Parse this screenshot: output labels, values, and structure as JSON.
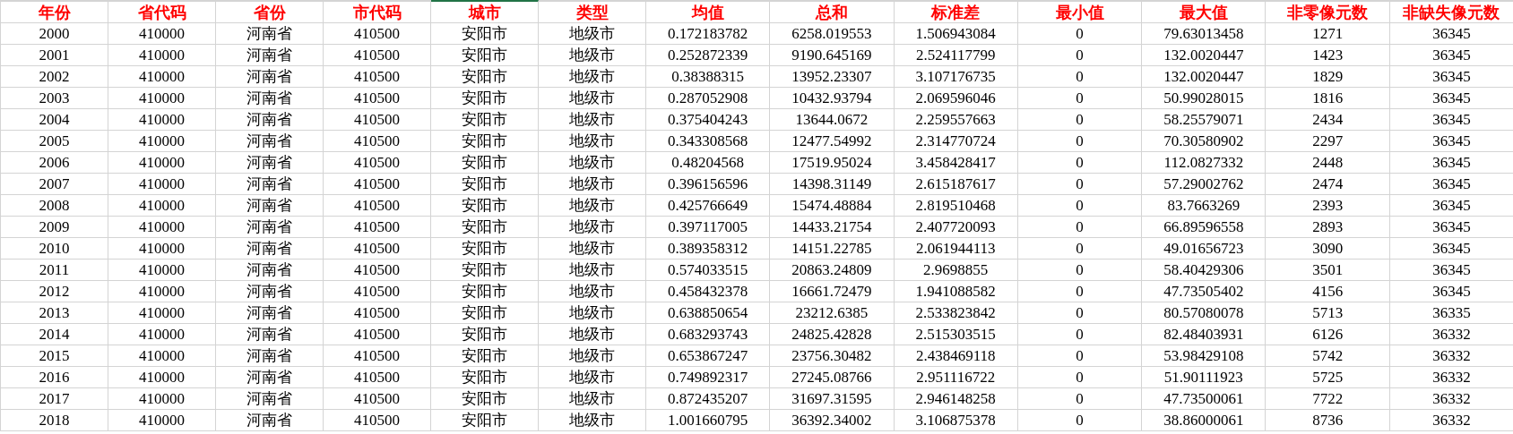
{
  "table": {
    "columns": [
      {
        "label": "年份",
        "selected": false
      },
      {
        "label": "省代码",
        "selected": false
      },
      {
        "label": "省份",
        "selected": false
      },
      {
        "label": "市代码",
        "selected": false
      },
      {
        "label": "城市",
        "selected": true
      },
      {
        "label": "类型",
        "selected": false
      },
      {
        "label": "均值",
        "selected": false
      },
      {
        "label": "总和",
        "selected": false
      },
      {
        "label": "标准差",
        "selected": false
      },
      {
        "label": "最小值",
        "selected": false
      },
      {
        "label": "最大值",
        "selected": false
      },
      {
        "label": "非零像元数",
        "selected": false
      },
      {
        "label": "非缺失像元数",
        "selected": false
      }
    ],
    "rows": [
      [
        "2000",
        "410000",
        "河南省",
        "410500",
        "安阳市",
        "地级市",
        "0.172183782",
        "6258.019553",
        "1.506943084",
        "0",
        "79.63013458",
        "1271",
        "36345"
      ],
      [
        "2001",
        "410000",
        "河南省",
        "410500",
        "安阳市",
        "地级市",
        "0.252872339",
        "9190.645169",
        "2.524117799",
        "0",
        "132.0020447",
        "1423",
        "36345"
      ],
      [
        "2002",
        "410000",
        "河南省",
        "410500",
        "安阳市",
        "地级市",
        "0.38388315",
        "13952.23307",
        "3.107176735",
        "0",
        "132.0020447",
        "1829",
        "36345"
      ],
      [
        "2003",
        "410000",
        "河南省",
        "410500",
        "安阳市",
        "地级市",
        "0.287052908",
        "10432.93794",
        "2.069596046",
        "0",
        "50.99028015",
        "1816",
        "36345"
      ],
      [
        "2004",
        "410000",
        "河南省",
        "410500",
        "安阳市",
        "地级市",
        "0.375404243",
        "13644.0672",
        "2.259557663",
        "0",
        "58.25579071",
        "2434",
        "36345"
      ],
      [
        "2005",
        "410000",
        "河南省",
        "410500",
        "安阳市",
        "地级市",
        "0.343308568",
        "12477.54992",
        "2.314770724",
        "0",
        "70.30580902",
        "2297",
        "36345"
      ],
      [
        "2006",
        "410000",
        "河南省",
        "410500",
        "安阳市",
        "地级市",
        "0.48204568",
        "17519.95024",
        "3.458428417",
        "0",
        "112.0827332",
        "2448",
        "36345"
      ],
      [
        "2007",
        "410000",
        "河南省",
        "410500",
        "安阳市",
        "地级市",
        "0.396156596",
        "14398.31149",
        "2.615187617",
        "0",
        "57.29002762",
        "2474",
        "36345"
      ],
      [
        "2008",
        "410000",
        "河南省",
        "410500",
        "安阳市",
        "地级市",
        "0.425766649",
        "15474.48884",
        "2.819510468",
        "0",
        "83.7663269",
        "2393",
        "36345"
      ],
      [
        "2009",
        "410000",
        "河南省",
        "410500",
        "安阳市",
        "地级市",
        "0.397117005",
        "14433.21754",
        "2.407720093",
        "0",
        "66.89596558",
        "2893",
        "36345"
      ],
      [
        "2010",
        "410000",
        "河南省",
        "410500",
        "安阳市",
        "地级市",
        "0.389358312",
        "14151.22785",
        "2.061944113",
        "0",
        "49.01656723",
        "3090",
        "36345"
      ],
      [
        "2011",
        "410000",
        "河南省",
        "410500",
        "安阳市",
        "地级市",
        "0.574033515",
        "20863.24809",
        "2.9698855",
        "0",
        "58.40429306",
        "3501",
        "36345"
      ],
      [
        "2012",
        "410000",
        "河南省",
        "410500",
        "安阳市",
        "地级市",
        "0.458432378",
        "16661.72479",
        "1.941088582",
        "0",
        "47.73505402",
        "4156",
        "36345"
      ],
      [
        "2013",
        "410000",
        "河南省",
        "410500",
        "安阳市",
        "地级市",
        "0.638850654",
        "23212.6385",
        "2.533823842",
        "0",
        "80.57080078",
        "5713",
        "36335"
      ],
      [
        "2014",
        "410000",
        "河南省",
        "410500",
        "安阳市",
        "地级市",
        "0.683293743",
        "24825.42828",
        "2.515303515",
        "0",
        "82.48403931",
        "6126",
        "36332"
      ],
      [
        "2015",
        "410000",
        "河南省",
        "410500",
        "安阳市",
        "地级市",
        "0.653867247",
        "23756.30482",
        "2.438469118",
        "0",
        "53.98429108",
        "5742",
        "36332"
      ],
      [
        "2016",
        "410000",
        "河南省",
        "410500",
        "安阳市",
        "地级市",
        "0.749892317",
        "27245.08766",
        "2.951116722",
        "0",
        "51.90111923",
        "5725",
        "36332"
      ],
      [
        "2017",
        "410000",
        "河南省",
        "410500",
        "安阳市",
        "地级市",
        "0.872435207",
        "31697.31595",
        "2.946148258",
        "0",
        "47.73500061",
        "7722",
        "36332"
      ],
      [
        "2018",
        "410000",
        "河南省",
        "410500",
        "安阳市",
        "地级市",
        "1.001660795",
        "36392.34002",
        "3.106875378",
        "0",
        "38.86000061",
        "8736",
        "36332"
      ]
    ]
  }
}
